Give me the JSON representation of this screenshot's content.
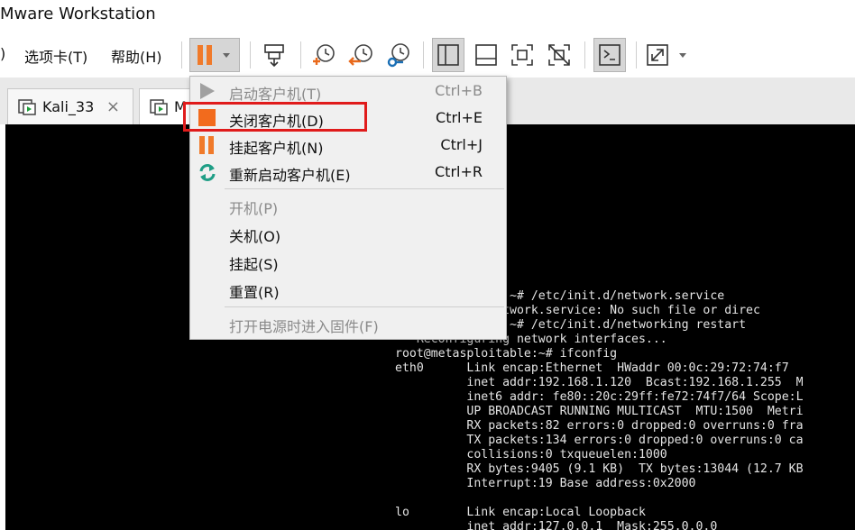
{
  "app": {
    "title": "Mware Workstation"
  },
  "menu": {
    "items": [
      {
        "label": ")"
      },
      {
        "label": "选项卡(T)"
      },
      {
        "label": "帮助(H)"
      }
    ]
  },
  "toolbar": {
    "icons": [
      "pause-dropdown-icon",
      "send-keys-icon",
      "snapshot-icon",
      "revert-snapshot-icon",
      "snapshot-manager-icon",
      "show-library-icon",
      "thumbnail-bar-icon",
      "fullscreen-icon",
      "unity-icon",
      "console-view-icon",
      "stretch-dropdown-icon"
    ],
    "colors": {
      "pause": "#f07a2a",
      "snapshot_orange": "#e96a1c",
      "snapshot_blue": "#1a6fb5",
      "active_bg": "#d6d6d6"
    }
  },
  "tabs": [
    {
      "label": "Kali_33",
      "close": "×"
    },
    {
      "label": "M"
    }
  ],
  "power_menu": {
    "items": [
      {
        "label": "启动客户机(T)",
        "shortcut": "Ctrl+B",
        "disabled": true,
        "icon": "play-icon"
      },
      {
        "label": "关闭客户机(D)",
        "shortcut": "Ctrl+E",
        "disabled": false,
        "icon": "stop-icon",
        "highlighted": true
      },
      {
        "label": "挂起客户机(N)",
        "shortcut": "Ctrl+J",
        "disabled": false,
        "icon": "suspend-icon"
      },
      {
        "label": "重新启动客户机(E)",
        "shortcut": "Ctrl+R",
        "disabled": false,
        "icon": "restart-icon"
      },
      {
        "label": "开机(P)",
        "disabled": true
      },
      {
        "label": "关机(O)",
        "disabled": false
      },
      {
        "label": "挂起(S)",
        "disabled": false
      },
      {
        "label": "重置(R)",
        "disabled": false
      },
      {
        "label": "打开电源时进入固件(F)",
        "disabled": true
      }
    ],
    "colors": {
      "highlight_border": "#e01b1b",
      "stop": "#f26b1d",
      "restart": "#1f9e86",
      "play_disabled": "#a0a0a0"
    }
  },
  "console": {
    "lines": [
      "        oitable:~# /etc/init.d/network.service",
      "        it.d/network.service: No such file or direc",
      "        oitable:~# /etc/init.d/networking restart",
      " * Reconfiguring network interfaces...",
      "root@metasploitable:~# ifconfig",
      "eth0      Link encap:Ethernet  HWaddr 00:0c:29:72:74:f7",
      "          inet addr:192.168.1.120  Bcast:192.168.1.255  M",
      "          inet6 addr: fe80::20c:29ff:fe72:74f7/64 Scope:L",
      "          UP BROADCAST RUNNING MULTICAST  MTU:1500  Metri",
      "          RX packets:82 errors:0 dropped:0 overruns:0 fra",
      "          TX packets:134 errors:0 dropped:0 overruns:0 ca",
      "          collisions:0 txqueuelen:1000",
      "          RX bytes:9405 (9.1 KB)  TX bytes:13044 (12.7 KB",
      "          Interrupt:19 Base address:0x2000",
      "",
      "lo        Link encap:Local Loopback",
      "          inet addr:127.0.0.1  Mask:255.0.0.0"
    ]
  }
}
